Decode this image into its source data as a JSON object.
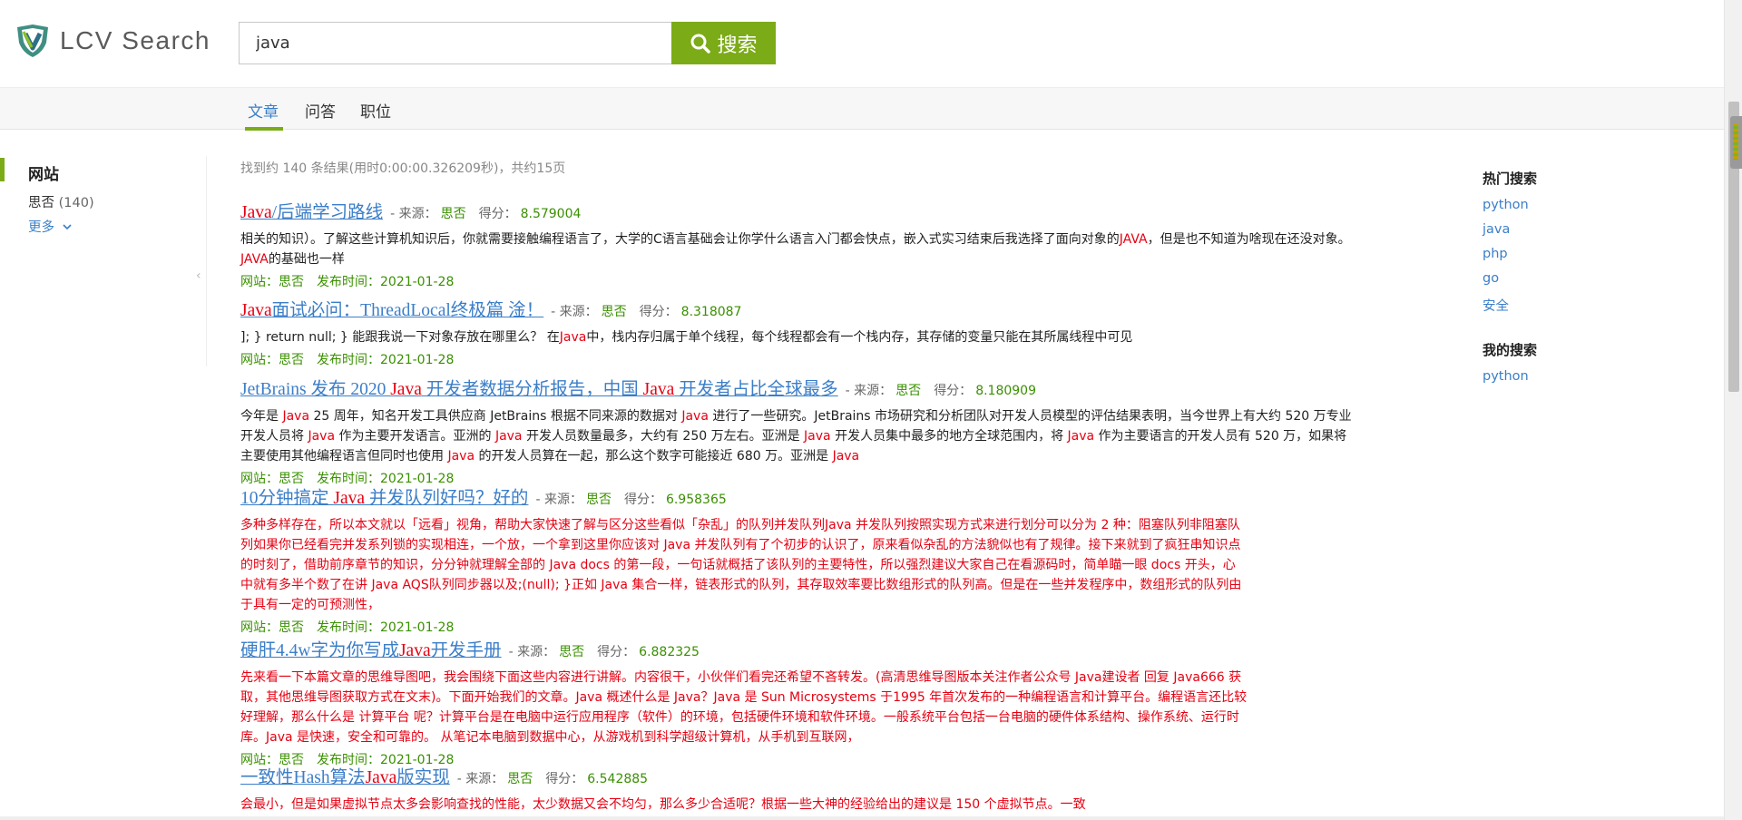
{
  "brand": {
    "name": "LCV Search",
    "accent": "#7cab18",
    "link": "#3b7ec8",
    "highlight": "#e60012"
  },
  "search": {
    "value": "java",
    "button_label": "搜索"
  },
  "tabs": [
    {
      "label": "文章",
      "active": true
    },
    {
      "label": "问答",
      "active": false
    },
    {
      "label": "职位",
      "active": false
    }
  ],
  "left": {
    "title": "网站",
    "site": {
      "name": "思否",
      "count": "(140)"
    },
    "more_label": "更多"
  },
  "summary": "找到约 140 条结果(用时0:00:00.326209秒)，共约15页",
  "result_labels": {
    "source": "- 来源：",
    "score": "得分：",
    "site": "网站：",
    "date": "发布时间："
  },
  "results": [
    {
      "title_parts": [
        {
          "t": "Java",
          "hl": true
        },
        {
          "t": "/后端学习路线",
          "hl": false
        }
      ],
      "source": "思否",
      "score": "8.579004",
      "snippet_red": false,
      "snippet_parts": [
        {
          "t": "相关的知识）。了解这些计算机知识后，你就需要接触编程语言了，大学的C语言基础会让你学什么语言入门都会快点，嵌入式实习结束后我选择了面向对象的",
          "hl": false
        },
        {
          "t": "JAVA",
          "hl": true
        },
        {
          "t": "，但是也不知道为啥现在还没对象。",
          "hl": false
        },
        {
          "t": "JAVA",
          "hl": true
        },
        {
          "t": "的基础也一样",
          "hl": false
        }
      ],
      "site": "思否",
      "date": "2021-01-28"
    },
    {
      "title_parts": [
        {
          "t": "Java",
          "hl": true
        },
        {
          "t": "面试必问：ThreadLocal终极篇 淦！",
          "hl": false
        }
      ],
      "source": "思否",
      "score": "8.318087",
      "snippet_red": false,
      "snippet_parts": [
        {
          "t": "]; } return null; } 能跟我说一下对象存放在哪里么？ 在",
          "hl": false
        },
        {
          "t": "Java",
          "hl": true
        },
        {
          "t": "中，栈内存归属于单个线程，每个线程都会有一个栈内存，其存储的变量只能在其所属线程中可见",
          "hl": false
        }
      ],
      "site": "思否",
      "date": "2021-01-28"
    },
    {
      "title_parts": [
        {
          "t": "JetBrains 发布 2020 ",
          "hl": false
        },
        {
          "t": "Java",
          "hl": true
        },
        {
          "t": " 开发者数据分析报告，中国 ",
          "hl": false
        },
        {
          "t": "Java",
          "hl": true
        },
        {
          "t": " 开发者占比全球最多",
          "hl": false
        }
      ],
      "source": "思否",
      "score": "8.180909",
      "snippet_red": false,
      "snippet_parts": [
        {
          "t": "今年是 ",
          "hl": false
        },
        {
          "t": "Java",
          "hl": true
        },
        {
          "t": " 25 周年，知名开发工具供应商 JetBrains 根据不同来源的数据对 ",
          "hl": false
        },
        {
          "t": "Java",
          "hl": true
        },
        {
          "t": " 进行了一些研究。JetBrains 市场研究和分析团队对开发人员模型的评估结果表明，当今世界上有大约 520 万专业开发人员将 ",
          "hl": false
        },
        {
          "t": "Java",
          "hl": true
        },
        {
          "t": " 作为主要开发语言。亚洲的 ",
          "hl": false
        },
        {
          "t": "Java",
          "hl": true
        },
        {
          "t": " 开发人员数量最多，大约有 250 万左右。亚洲是 ",
          "hl": false
        },
        {
          "t": "Java",
          "hl": true
        },
        {
          "t": " 开发人员集中最多的地方全球范围内，将 ",
          "hl": false
        },
        {
          "t": "Java",
          "hl": true
        },
        {
          "t": " 作为主要语言的开发人员有 520 万，如果将主要使用其他编程语言但同时也使用 ",
          "hl": false
        },
        {
          "t": "Java",
          "hl": true
        },
        {
          "t": " 的开发人员算在一起，那么这个数字可能接近 680 万。亚洲是 ",
          "hl": false
        },
        {
          "t": "Java",
          "hl": true
        }
      ],
      "site": "思否",
      "date": "2021-01-28"
    },
    {
      "title_parts": [
        {
          "t": "10分钟搞定 ",
          "hl": false
        },
        {
          "t": "Java",
          "hl": true
        },
        {
          "t": " 并发队列好吗？好的",
          "hl": false
        }
      ],
      "source": "思否",
      "score": "6.958365",
      "snippet_red": true,
      "snippet_parts": [
        {
          "t": "多种多样存在，所以本文就以「远看」视角，帮助大家快速了解与区分这些看似「杂乱」的队列并发队列Java 并发队列按照实现方式来进行划分可以分为 2 种：阻塞队列非阻塞队列如果你已经看完并发系列锁的实现相连，一个放，一个拿到这里你应该对 Java 并发队列有了个初步的认识了，原来看似杂乱的方法貌似也有了规律。接下来就到了疯狂串知识点的时刻了，借助前序章节的知识，分分钟就理解全部的 Java docs 的第一段，一句话就概括了该队列的主要特性，所以强烈建议大家自己在看源码时，简单瞄一眼 docs 开头，心中就有多半个数了在讲 Java AQS队列同步器以及;(null); }正如 Java 集合一样，链表形式的队列，其存取效率要比数组形式的队列高。但是在一些并发程序中，数组形式的队列由于具有一定的可预测性，",
          "hl": false
        }
      ],
      "site": "思否",
      "date": "2021-01-28"
    },
    {
      "title_parts": [
        {
          "t": "硬肝4.4w字为你写成",
          "hl": false
        },
        {
          "t": "Java",
          "hl": true
        },
        {
          "t": "开发手册",
          "hl": false
        }
      ],
      "source": "思否",
      "score": "6.882325",
      "snippet_red": true,
      "snippet_parts": [
        {
          "t": "先来看一下本篇文章的思维导图吧，我会围绕下面这些内容进行讲解。内容很干，小伙伴们看完还希望不吝转发。(高清思维导图版本关注作者公众号 Java建设者 回复 Java666 获取，其他思维导图获取方式在文末)。下面开始我们的文章。Java 概述什么是 Java？Java 是 Sun Microsystems 于1995 年首次发布的一种编程语言和计算平台。编程语言还比较好理解，那么什么是 计算平台 呢？计算平台是在电脑中运行应用程序（软件）的环境，包括硬件环境和软件环境。一般系统平台包括一台电脑的硬件体系结构、操作系统、运行时库。Java 是快速，安全和可靠的。 从笔记本电脑到数据中心，从游戏机到科学超级计算机，从手机到互联网，",
          "hl": false
        }
      ],
      "site": "思否",
      "date": "2021-01-28"
    },
    {
      "title_parts": [
        {
          "t": "一致性Hash算法",
          "hl": false
        },
        {
          "t": "Java",
          "hl": true
        },
        {
          "t": "版实现",
          "hl": false
        }
      ],
      "source": "思否",
      "score": "6.542885",
      "snippet_red": true,
      "snippet_parts": [
        {
          "t": "会最小，但是如果虚拟节点太多会影响查找的性能，太少数据又会不均匀，那么多少合适呢？根据一些大神的经验给出的建议是 150 个虚拟节点。一致",
          "hl": false
        }
      ],
      "site": "",
      "date": ""
    }
  ],
  "right": {
    "hot_title": "热门搜索",
    "hot": [
      "python",
      "java",
      "php",
      "go",
      "安全"
    ],
    "mine_title": "我的搜索",
    "mine": [
      "python"
    ]
  }
}
